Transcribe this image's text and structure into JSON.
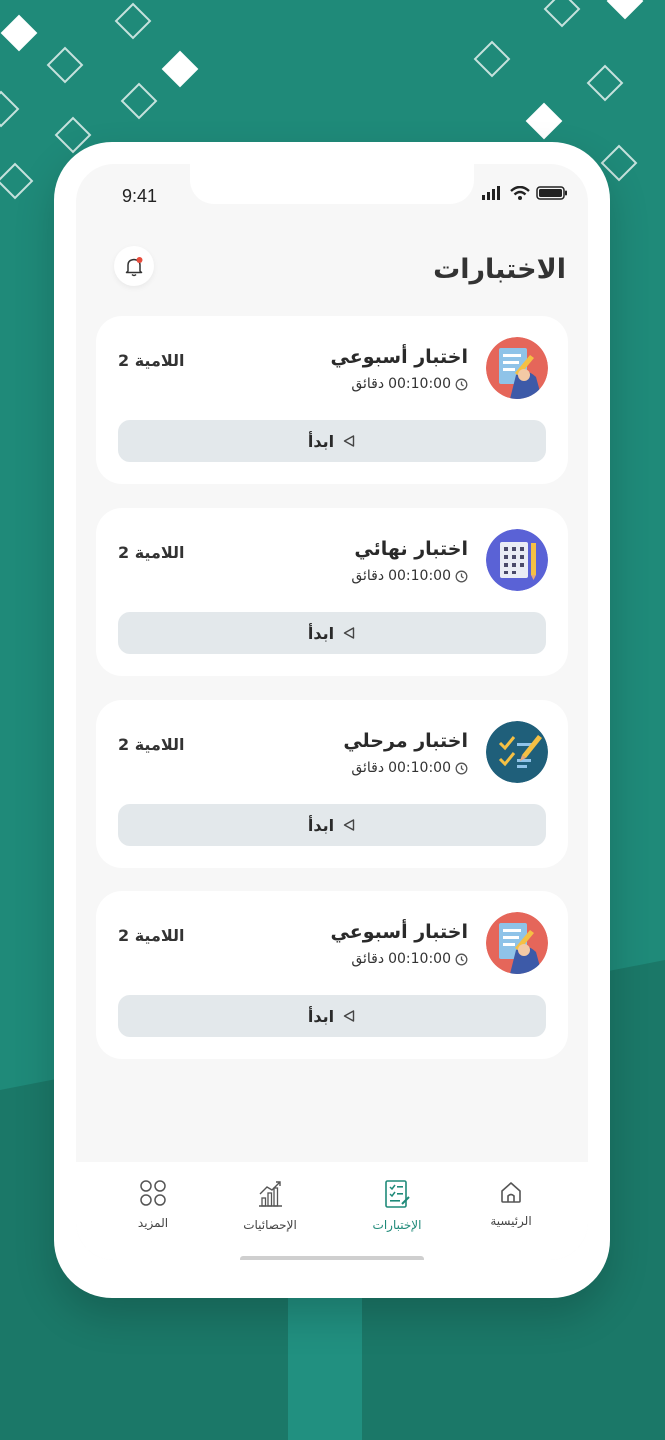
{
  "status_bar": {
    "time": "9:41"
  },
  "header": {
    "title": "الاختبارات"
  },
  "icons": {
    "bell": "bell-icon",
    "clock": "clock-icon",
    "play": "play-triangle-icon"
  },
  "colors": {
    "brand": "#1f8a79",
    "card_button_bg": "#e3e8eb",
    "notification_dot": "#e74c3c"
  },
  "quizzes": [
    {
      "title": "اختبار أسبوعي",
      "duration": "00:10:00",
      "duration_unit": "دقائق",
      "level": "اللامية 2",
      "start_label": "ابدأ",
      "icon": "weekly-exam-icon"
    },
    {
      "title": "اختبار نهائي",
      "duration": "00:10:00",
      "duration_unit": "دقائق",
      "level": "اللامية 2",
      "start_label": "ابدأ",
      "icon": "final-exam-icon"
    },
    {
      "title": "اختبار مرحلي",
      "duration": "00:10:00",
      "duration_unit": "دقائق",
      "level": "اللامية 2",
      "start_label": "ابدأ",
      "icon": "stage-exam-icon"
    },
    {
      "title": "اختبار أسبوعي",
      "duration": "00:10:00",
      "duration_unit": "دقائق",
      "level": "اللامية 2",
      "start_label": "ابدأ",
      "icon": "weekly-exam-icon"
    }
  ],
  "tabs": [
    {
      "label": "الرئيسية",
      "icon": "home-icon",
      "active": false
    },
    {
      "label": "الإختبارات",
      "icon": "exam-icon",
      "active": true
    },
    {
      "label": "الإحصائيات",
      "icon": "stats-icon",
      "active": false
    },
    {
      "label": "المزيد",
      "icon": "more-grid-icon",
      "active": false
    }
  ]
}
